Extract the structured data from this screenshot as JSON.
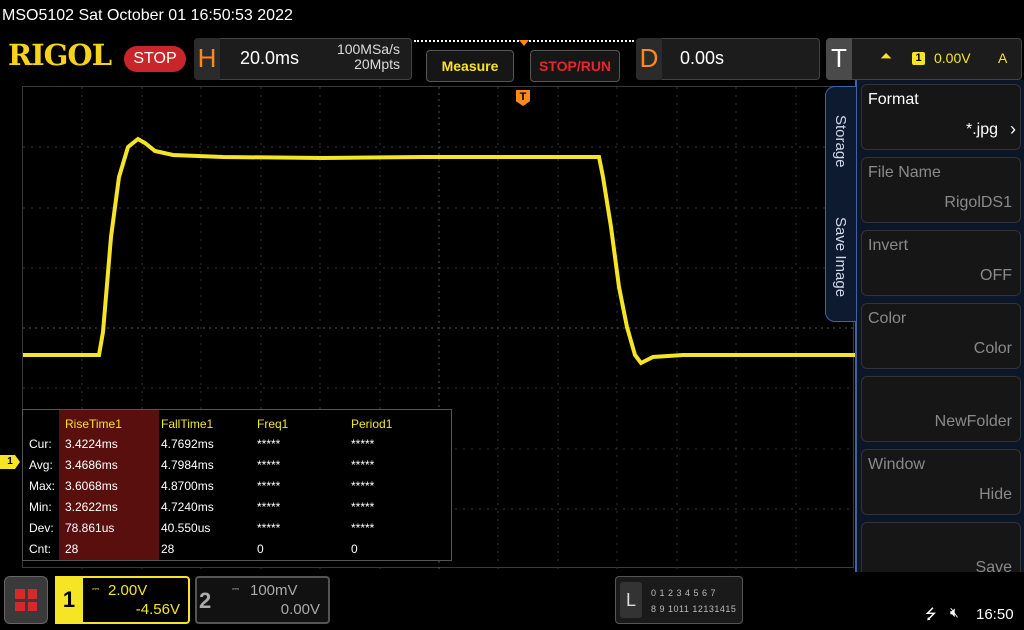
{
  "status_line": "MSO5102  Sat October 01 16:50:53 2022",
  "header": {
    "logo": "RIGOL",
    "run_state": "STOP",
    "horizontal": {
      "key": "H",
      "timebase": "20.0ms",
      "sample_rate": "100MSa/s",
      "memory_depth": "20Mpts"
    },
    "measure_label": "Measure",
    "stoprun_label": "STOP/RUN",
    "delay": {
      "key": "D",
      "value": "0.00s"
    },
    "trigger": {
      "key": "T",
      "channel": "1",
      "level": "0.00V",
      "mode": "A"
    }
  },
  "markers": {
    "trigger": "T",
    "channel1": "1"
  },
  "measurements": {
    "headers": [
      "RiseTime1",
      "FallTime1",
      "Freq1",
      "Period1"
    ],
    "rows": [
      {
        "label": "Cur:",
        "values": [
          "3.4224ms",
          "4.7692ms",
          "*****",
          "*****"
        ]
      },
      {
        "label": "Avg:",
        "values": [
          "3.4686ms",
          "4.7984ms",
          "*****",
          "*****"
        ]
      },
      {
        "label": "Max:",
        "values": [
          "3.6068ms",
          "4.8700ms",
          "*****",
          "*****"
        ]
      },
      {
        "label": "Min:",
        "values": [
          "3.2622ms",
          "4.7240ms",
          "*****",
          "*****"
        ]
      },
      {
        "label": "Dev:",
        "values": [
          "78.861us",
          "40.550us",
          "*****",
          "*****"
        ]
      },
      {
        "label": "Cnt:",
        "values": [
          "28",
          "28",
          "0",
          "0"
        ]
      }
    ]
  },
  "side_tab": {
    "tab1": "Storage",
    "tab2": "Save Image"
  },
  "side_menu": [
    {
      "title": "Format",
      "value": "*.jpg"
    },
    {
      "title": "File Name",
      "value": "RigolDS1"
    },
    {
      "title": "Invert",
      "value": "OFF"
    },
    {
      "title": "Color",
      "value": "Color"
    },
    {
      "title": "",
      "value": "NewFolder"
    },
    {
      "title": "Window",
      "value": "Hide"
    },
    {
      "title": "",
      "value": "Save"
    }
  ],
  "channels": {
    "ch1": {
      "number": "1",
      "scale": "2.00V",
      "offset": "-4.56V"
    },
    "ch2": {
      "number": "2",
      "scale": "100mV",
      "offset": "0.00V"
    }
  },
  "logic": {
    "key": "L",
    "row1": "0 1 2 3  4 5 6 7",
    "row2": "8 9 1011 12131415"
  },
  "clock": "16:50",
  "colors": {
    "ch1": "#f5e524",
    "trigger": "#ff8a1c",
    "stop": "#c9262b",
    "menu_accent": "#3c64a8"
  }
}
